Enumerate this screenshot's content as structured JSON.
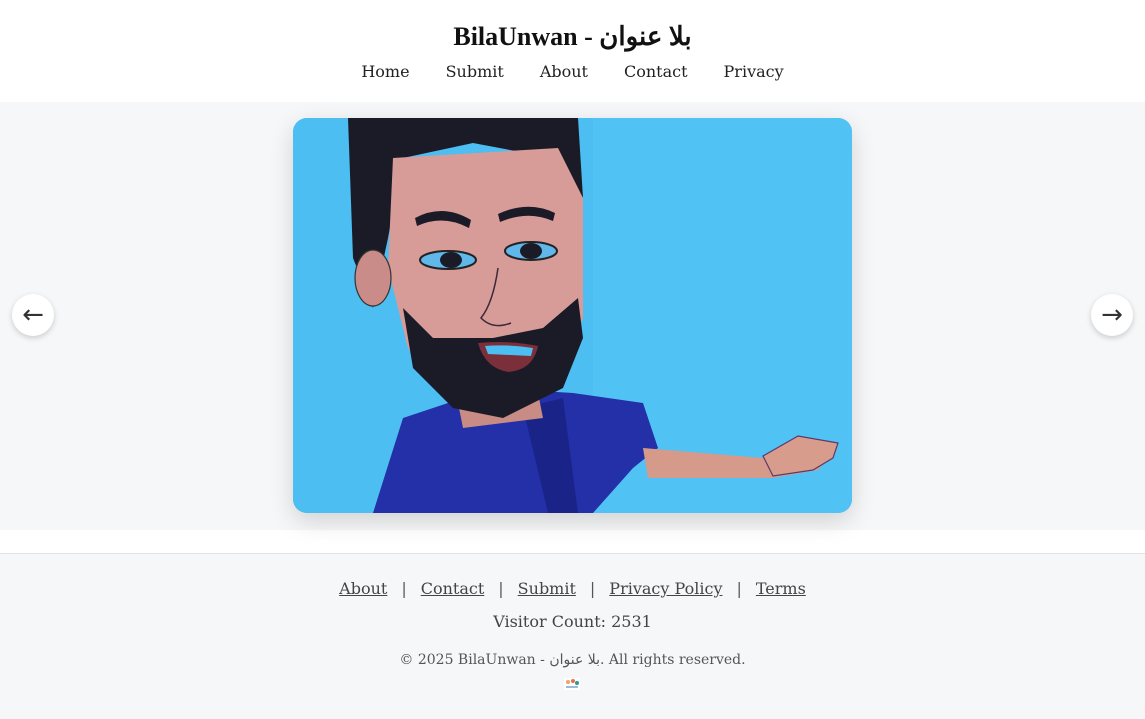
{
  "header": {
    "title": "BilaUnwan - بلا عنوان",
    "nav": [
      "Home",
      "Submit",
      "About",
      "Contact",
      "Privacy"
    ]
  },
  "gallery": {
    "prev_icon": "←",
    "next_icon": "→"
  },
  "footer": {
    "links": [
      "About",
      "Contact",
      "Submit",
      "Privacy Policy",
      "Terms"
    ],
    "separator": "|",
    "visitor_count": "Visitor Count: 2531",
    "copyright": "© 2025 BilaUnwan - بلا عنوان. All rights reserved."
  },
  "colors": {
    "slide_background": "#4bbdf0",
    "page_background": "#f6f7f8"
  }
}
